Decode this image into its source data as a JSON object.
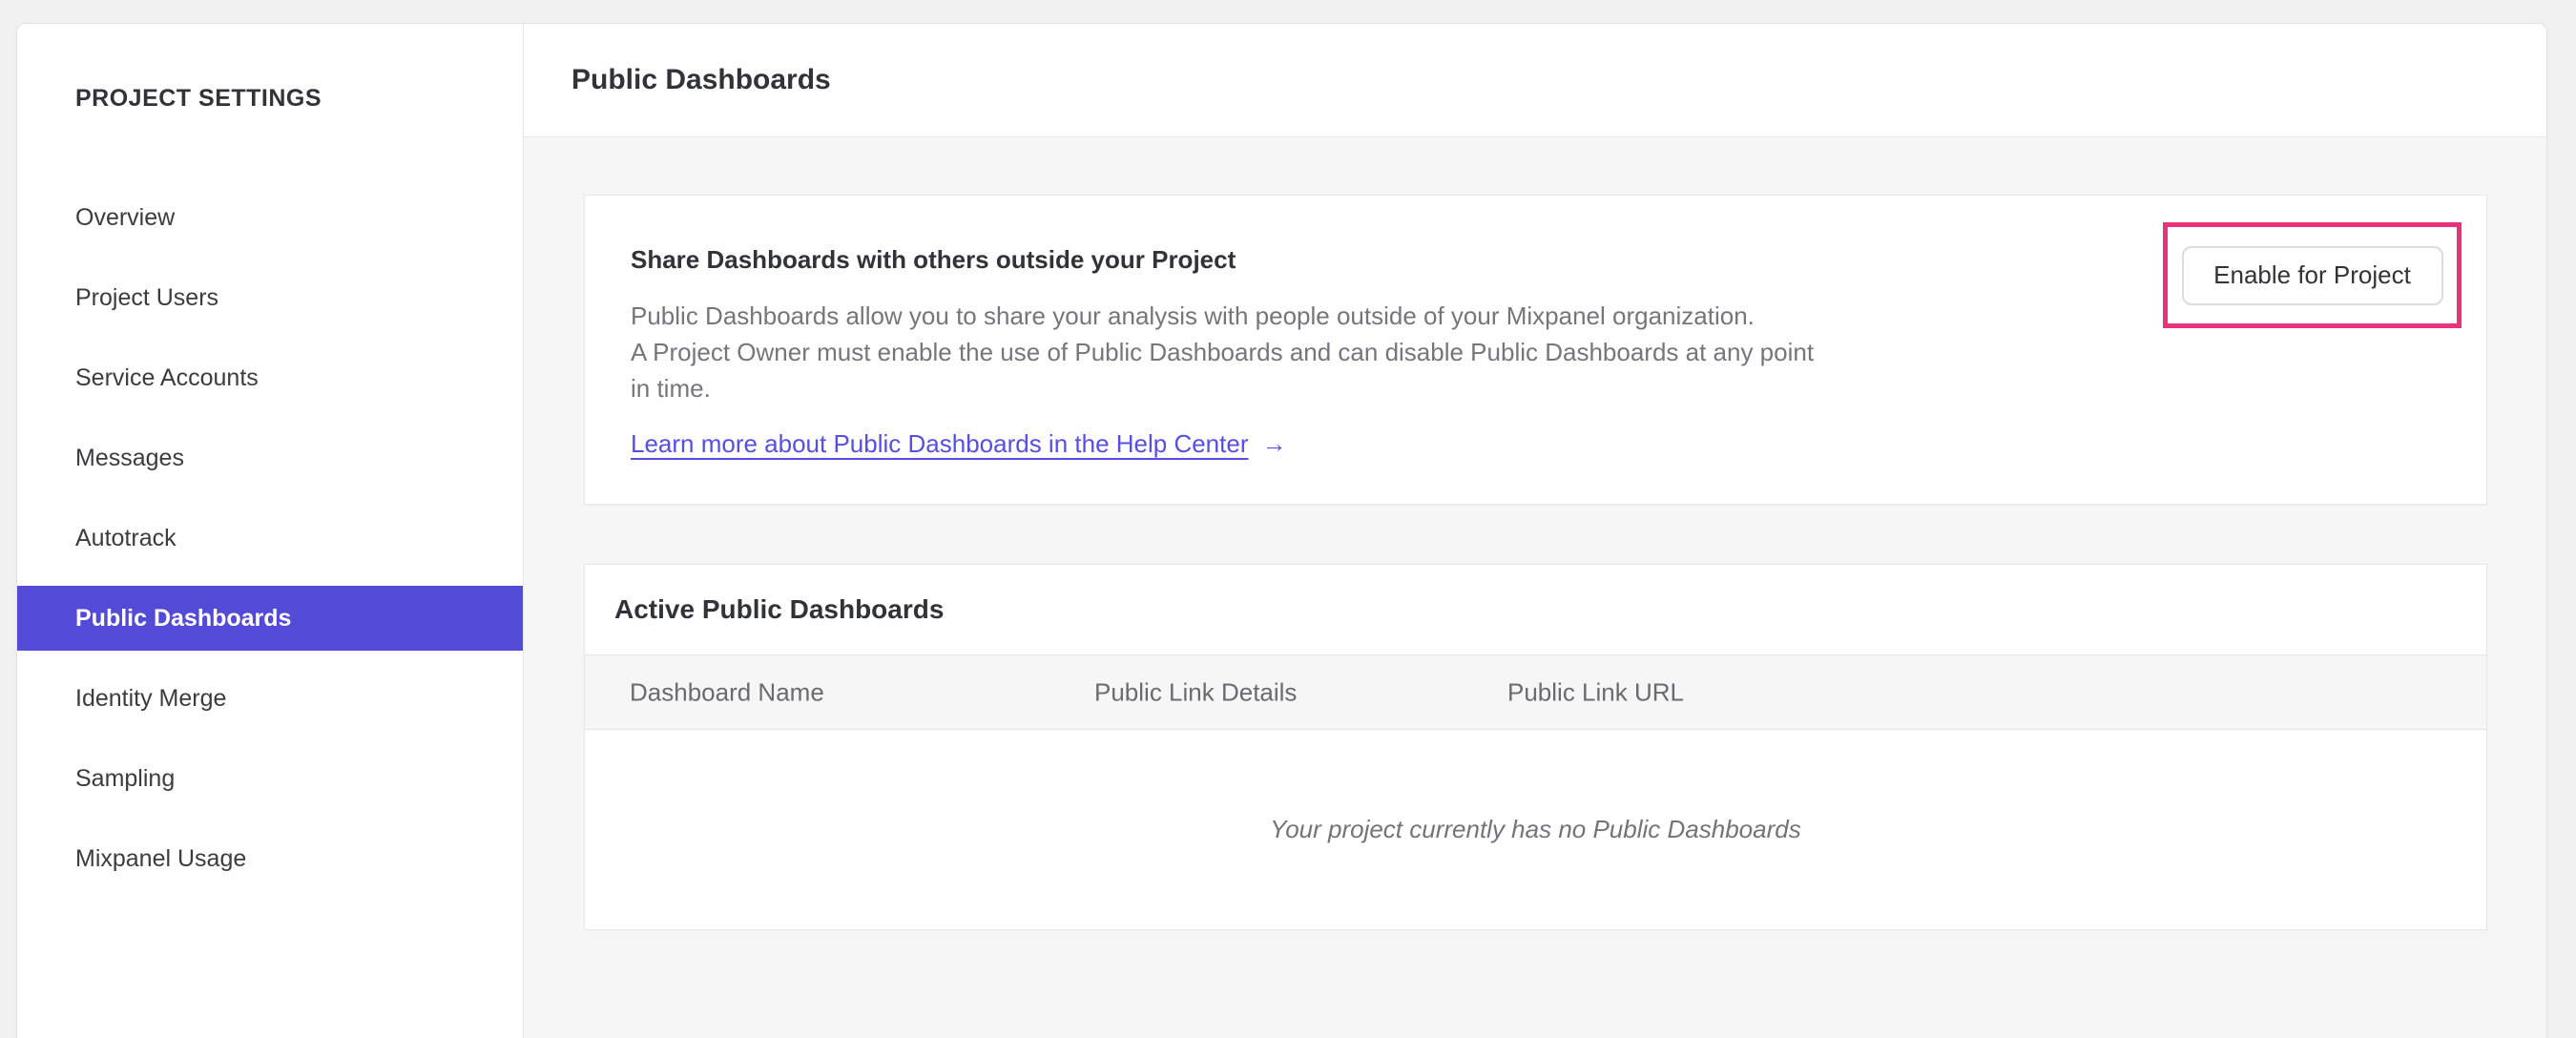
{
  "colors": {
    "accent": "#544ad8",
    "link": "#574ee2",
    "annotation": "#e8327c",
    "content-bg": "#f6f6f7"
  },
  "sidebar": {
    "title": "PROJECT SETTINGS",
    "items": [
      {
        "label": "Overview",
        "selected": false
      },
      {
        "label": "Project Users",
        "selected": false
      },
      {
        "label": "Service Accounts",
        "selected": false
      },
      {
        "label": "Messages",
        "selected": false
      },
      {
        "label": "Autotrack",
        "selected": false
      },
      {
        "label": "Public Dashboards",
        "selected": true
      },
      {
        "label": "Identity Merge",
        "selected": false
      },
      {
        "label": "Sampling",
        "selected": false
      },
      {
        "label": "Mixpanel Usage",
        "selected": false
      }
    ]
  },
  "header": {
    "title": "Public Dashboards"
  },
  "share_card": {
    "title": "Share Dashboards with others outside your Project",
    "body_lines": [
      "Public Dashboards allow you to share your analysis with people outside of your Mixpanel organization.",
      "A Project Owner must enable the use of Public Dashboards and can disable Public Dashboards at any point",
      "in time."
    ],
    "link_label": "Learn more about Public Dashboards in the Help Center",
    "link_arrow": "→",
    "enable_button_label": "Enable for Project"
  },
  "active_card": {
    "title": "Active Public Dashboards",
    "columns": [
      "Dashboard Name",
      "Public Link Details",
      "Public Link URL"
    ],
    "empty_message": "Your project currently has no Public Dashboards",
    "rows": []
  }
}
